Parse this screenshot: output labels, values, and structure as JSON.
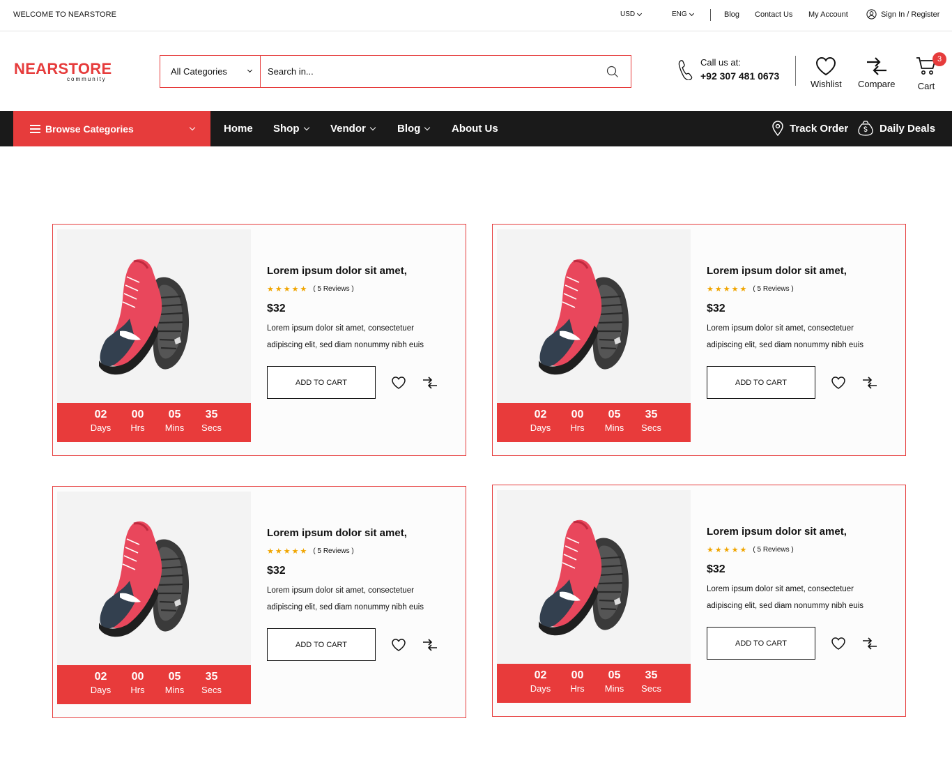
{
  "topbar": {
    "welcome": "WELCOME TO NEARSTORE",
    "currency": "USD",
    "language": "ENG",
    "links": [
      "Blog",
      "Contact Us",
      "My Account"
    ],
    "signin": "Sign In / Register"
  },
  "header": {
    "logo_main": "NEARSTORE",
    "logo_sub": "community",
    "category_select": "All Categories",
    "search_placeholder": "Search in...",
    "call_label": "Call us at:",
    "call_number": "+92 307 481 0673",
    "wishlist": "Wishlist",
    "compare": "Compare",
    "cart": "Cart",
    "cart_count": "3"
  },
  "nav": {
    "browse": "Browse Categories",
    "links": [
      "Home",
      "Shop",
      "Vendor",
      "Blog",
      "About Us"
    ],
    "track_order": "Track Order",
    "daily_deals": "Daily Deals"
  },
  "products": [
    {
      "title": "Lorem ipsum dolor sit amet,",
      "reviews": "( 5 Reviews )",
      "rating": 5,
      "price": "$32",
      "description": "Lorem ipsum dolor sit amet, consectetuer adipiscing elit, sed diam nonummy nibh euis",
      "add_to_cart": "ADD TO CART",
      "countdown": [
        {
          "value": "02",
          "label": "Days"
        },
        {
          "value": "00",
          "label": "Hrs"
        },
        {
          "value": "05",
          "label": "Mins"
        },
        {
          "value": "35",
          "label": "Secs"
        }
      ]
    },
    {
      "title": "Lorem ipsum dolor sit amet,",
      "reviews": "( 5 Reviews )",
      "rating": 5,
      "price": "$32",
      "description": "Lorem ipsum dolor sit amet, consectetuer adipiscing elit, sed diam nonummy nibh euis",
      "add_to_cart": "ADD TO CART",
      "countdown": [
        {
          "value": "02",
          "label": "Days"
        },
        {
          "value": "00",
          "label": "Hrs"
        },
        {
          "value": "05",
          "label": "Mins"
        },
        {
          "value": "35",
          "label": "Secs"
        }
      ]
    },
    {
      "title": "Lorem ipsum dolor sit amet,",
      "reviews": "( 5 Reviews )",
      "rating": 5,
      "price": "$32",
      "description": "Lorem ipsum dolor sit amet, consectetuer adipiscing elit, sed diam nonummy nibh euis",
      "add_to_cart": "ADD TO CART",
      "countdown": [
        {
          "value": "02",
          "label": "Days"
        },
        {
          "value": "00",
          "label": "Hrs"
        },
        {
          "value": "05",
          "label": "Mins"
        },
        {
          "value": "35",
          "label": "Secs"
        }
      ]
    },
    {
      "title": "Lorem ipsum dolor sit amet,",
      "reviews": "( 5 Reviews )",
      "rating": 5,
      "price": "$32",
      "description": "Lorem ipsum dolor sit amet, consectetuer adipiscing elit, sed diam nonummy nibh euis",
      "add_to_cart": "ADD TO CART",
      "countdown": [
        {
          "value": "02",
          "label": "Days"
        },
        {
          "value": "00",
          "label": "Hrs"
        },
        {
          "value": "05",
          "label": "Mins"
        },
        {
          "value": "35",
          "label": "Secs"
        }
      ]
    }
  ],
  "colors": {
    "accent": "#e63c3c",
    "nav_bg": "#1a1a1a",
    "star": "#f0a500"
  }
}
